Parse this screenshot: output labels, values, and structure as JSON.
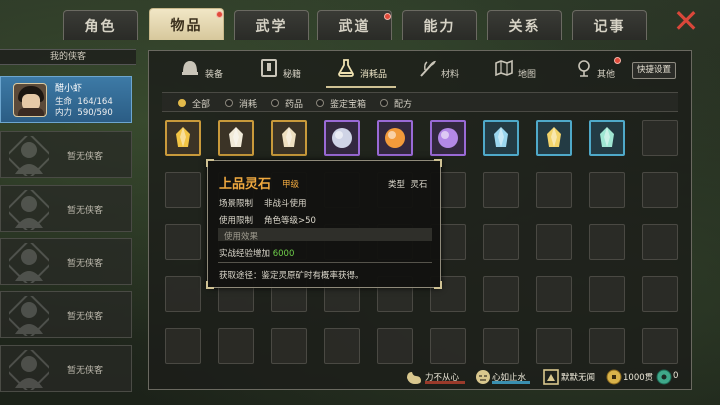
{
  "tabs": [
    {
      "label": "角色",
      "active": false,
      "dot": false
    },
    {
      "label": "物品",
      "active": true,
      "dot": true
    },
    {
      "label": "武学",
      "active": false,
      "dot": false
    },
    {
      "label": "武道",
      "active": false,
      "dot": true
    },
    {
      "label": "能力",
      "active": false,
      "dot": false
    },
    {
      "label": "关系",
      "active": false,
      "dot": false
    },
    {
      "label": "记事",
      "active": false,
      "dot": false
    }
  ],
  "close_icon": "close-icon",
  "party": {
    "header": "我的侠客",
    "hero": {
      "name": "醋小虾",
      "hp_label": "生命",
      "hp_value": "164/164",
      "mp_label": "内力",
      "mp_value": "590/590"
    },
    "empty_label": "暂无侠客"
  },
  "categories": [
    {
      "label": "装备",
      "icon": "helmet-icon",
      "active": false
    },
    {
      "label": "秘籍",
      "icon": "book-icon",
      "active": false
    },
    {
      "label": "消耗品",
      "icon": "potion-icon",
      "active": true
    },
    {
      "label": "材料",
      "icon": "herb-icon",
      "active": false
    },
    {
      "label": "地图",
      "icon": "map-icon",
      "active": false
    },
    {
      "label": "其他",
      "icon": "bell-icon",
      "active": false
    }
  ],
  "quick_setting": "快捷设置",
  "filters": [
    {
      "label": "全部",
      "selected": true
    },
    {
      "label": "消耗",
      "selected": false
    },
    {
      "label": "药品",
      "selected": false
    },
    {
      "label": "鉴定宝箱",
      "selected": false
    },
    {
      "label": "配方",
      "selected": false
    }
  ],
  "items": [
    {
      "quality": "gold",
      "icon": "gold-crystal-icon",
      "color": "#f2c444"
    },
    {
      "quality": "gold",
      "icon": "white-crystal-icon",
      "color": "#f1ead8"
    },
    {
      "quality": "gold",
      "icon": "white-crystal-icon",
      "color": "#eedfc0"
    },
    {
      "quality": "purple",
      "icon": "silver-orb-icon",
      "color": "#cfd4e6"
    },
    {
      "quality": "purple",
      "icon": "orange-orb-icon",
      "color": "#f29a3a"
    },
    {
      "quality": "purple",
      "icon": "purple-orb-icon",
      "color": "#b388e6"
    },
    {
      "quality": "blue",
      "icon": "blue-crystal-icon",
      "color": "#9bd7ef"
    },
    {
      "quality": "blue",
      "icon": "yellow-crystal-icon",
      "color": "#f2d36a"
    },
    {
      "quality": "blue",
      "icon": "cyan-crystal-icon",
      "color": "#9fe6d2"
    }
  ],
  "tooltip": {
    "title": "上品灵石",
    "grade": "甲级",
    "type_label": "类型",
    "type_value": "灵石",
    "scene_label": "场景限制",
    "scene_value": "非战斗使用",
    "use_label": "使用限制",
    "use_value": "角色等级>50",
    "effect_label": "使用效果",
    "effect_text": "实战经验增加",
    "effect_value": "6000",
    "source": "获取途径：鉴定灵原矿时有概率获得。"
  },
  "status": {
    "mood1": "力不从心",
    "mood2": "心如止水",
    "mood3": "默默无闻",
    "money": "1000贯",
    "gems": "0"
  },
  "colors": {
    "accent_gold": "#f0a93f",
    "green": "#6fcf4a",
    "tab_active": "#e8dcb4"
  }
}
